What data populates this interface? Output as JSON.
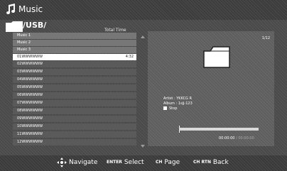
{
  "header": {
    "app_title": "Music",
    "path": "/USB/"
  },
  "list": {
    "col_total_time": "Total Time",
    "rows": [
      {
        "name": "Music 1",
        "time": "",
        "state": "light"
      },
      {
        "name": "Music 2",
        "time": "",
        "state": "light"
      },
      {
        "name": "Music 3",
        "time": "",
        "state": "light"
      },
      {
        "name": "01WWWWWW",
        "time": "4:32",
        "state": "selected"
      },
      {
        "name": "02WWWWWW",
        "time": "",
        "state": "dark"
      },
      {
        "name": "03WWWWWW",
        "time": "",
        "state": "dark"
      },
      {
        "name": "04WWWWWW",
        "time": "",
        "state": "dark"
      },
      {
        "name": "05WWWWWW",
        "time": "",
        "state": "dark"
      },
      {
        "name": "06WWWWWW",
        "time": "",
        "state": "dark"
      },
      {
        "name": "07WWWWWW",
        "time": "",
        "state": "dark"
      },
      {
        "name": "08WWWWWW",
        "time": "",
        "state": "dark"
      },
      {
        "name": "09WWWWWW",
        "time": "",
        "state": "dark"
      },
      {
        "name": "10WWWWWW",
        "time": "",
        "state": "dark"
      },
      {
        "name": "11WWWWWW",
        "time": "",
        "state": "dark"
      },
      {
        "name": "12WWWWWW",
        "time": "",
        "state": "dark"
      }
    ]
  },
  "preview": {
    "counter": "1/12",
    "artist": "Artist : YKKCG R",
    "album": "Album : 1sjj-123",
    "status": "Stop",
    "elapsed": "00:00:00",
    "total": "/ 00:00:00",
    "progress": 0
  },
  "footer": {
    "navigate": "Navigate",
    "enter_key": "ENTER",
    "select": "Select",
    "page_key": "CH",
    "page": "Page",
    "back_key": "CH RTN",
    "back": "Back"
  }
}
